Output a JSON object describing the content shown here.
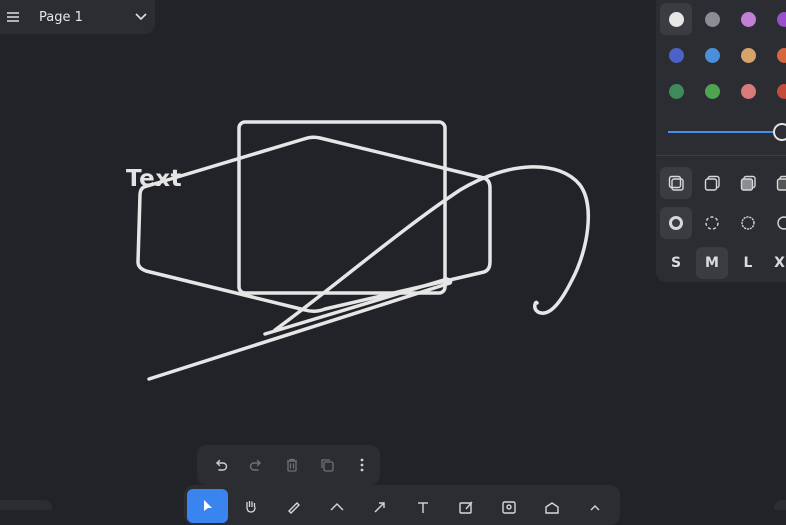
{
  "page_menu": {
    "page_name": "Page 1",
    "menu_icon": "hamburger-icon",
    "chevron_icon": "chevron-down-icon"
  },
  "canvas": {
    "text_label": "Text",
    "stroke_color": "#e6e6e6"
  },
  "style_panel": {
    "colors": [
      {
        "name": "white",
        "hex": "#e6e6e6",
        "selected": true
      },
      {
        "name": "grey",
        "hex": "#8a8d93"
      },
      {
        "name": "light-violet",
        "hex": "#c27fd6"
      },
      {
        "name": "violet",
        "hex": "#9a4fd0"
      },
      {
        "name": "blue",
        "hex": "#4b63c9"
      },
      {
        "name": "light-blue",
        "hex": "#4a8fd9"
      },
      {
        "name": "yellow",
        "hex": "#d6a36a"
      },
      {
        "name": "orange",
        "hex": "#d9663a"
      },
      {
        "name": "green",
        "hex": "#3f8a5a"
      },
      {
        "name": "light-green",
        "hex": "#4fa44f"
      },
      {
        "name": "light-red",
        "hex": "#d97a7a"
      },
      {
        "name": "red",
        "hex": "#c44a3a"
      }
    ],
    "opacity": 1,
    "fill_styles": [
      "fill-none-icon",
      "fill-semi-icon",
      "fill-solid-icon",
      "fill-pattern-icon"
    ],
    "dash_styles": [
      "dash-draw-icon",
      "dash-dashed-icon",
      "dash-dotted-icon",
      "dash-solid-icon"
    ],
    "sizes": [
      {
        "label": "S"
      },
      {
        "label": "M",
        "selected": true
      },
      {
        "label": "L"
      },
      {
        "label": "XL"
      }
    ]
  },
  "action_bar": [
    "undo-icon",
    "redo-icon",
    "trash-icon",
    "duplicate-icon",
    "more-icon"
  ],
  "toolbar": [
    "select-tool-icon",
    "hand-tool-icon",
    "draw-tool-icon",
    "eraser-tool-icon",
    "arrow-tool-icon",
    "text-tool-icon",
    "note-tool-icon",
    "image-tool-icon",
    "shape-tool-icon",
    "more-tools-icon"
  ]
}
